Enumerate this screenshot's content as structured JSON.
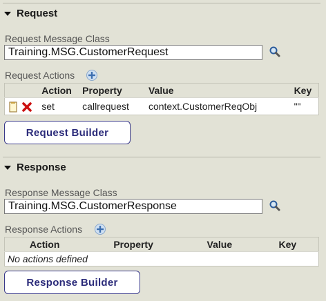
{
  "request": {
    "section_title": "Request",
    "message_class_label": "Request Message Class",
    "message_class_value": "Training.MSG.CustomerRequest",
    "actions_label": "Request Actions",
    "columns": [
      "Action",
      "Property",
      "Value",
      "Key"
    ],
    "rows": [
      {
        "action": "set",
        "property": "callrequest",
        "value": "context.CustomerReqObj",
        "key": "\"\""
      }
    ],
    "builder_button": "Request Builder"
  },
  "response": {
    "section_title": "Response",
    "message_class_label": "Response Message Class",
    "message_class_value": "Training.MSG.CustomerResponse",
    "actions_label": "Response Actions",
    "columns": [
      "Action",
      "Property",
      "Value",
      "Key"
    ],
    "empty_text": "No actions defined",
    "builder_button": "Response Builder"
  },
  "icons": {
    "collapse": "triangle-down-icon",
    "search": "magnifier-icon",
    "add": "plus-circle-icon",
    "edit": "document-edit-icon",
    "delete": "red-x-icon"
  },
  "colors": {
    "background": "#e2e2d6",
    "button_text": "#2b2b7a",
    "delete": "#cc1111"
  }
}
